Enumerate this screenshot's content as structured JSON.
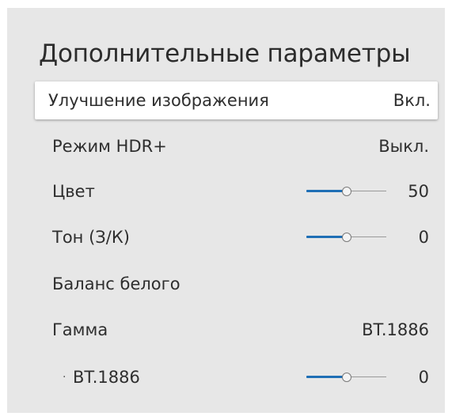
{
  "menu": {
    "title": "Дополнительные параметры",
    "items": [
      {
        "label": "Улучшение изображения",
        "value": "Вкл."
      },
      {
        "label": "Режим HDR+",
        "value": "Выкл."
      },
      {
        "label": "Цвет",
        "value": "50",
        "slider_level": 0.5
      },
      {
        "label": "Тон (З/К)",
        "value": "0",
        "slider_level": 0.5
      },
      {
        "label": "Баланс белого"
      },
      {
        "label": "Гамма",
        "value": "BT.1886"
      },
      {
        "label": "BT.1886",
        "value": "0",
        "slider_level": 0.5,
        "bullet": "·"
      }
    ]
  },
  "colors": {
    "slider_fill": "#1f6fb5",
    "panel_bg": "#e7e7e7",
    "selected_bg": "#ffffff"
  }
}
